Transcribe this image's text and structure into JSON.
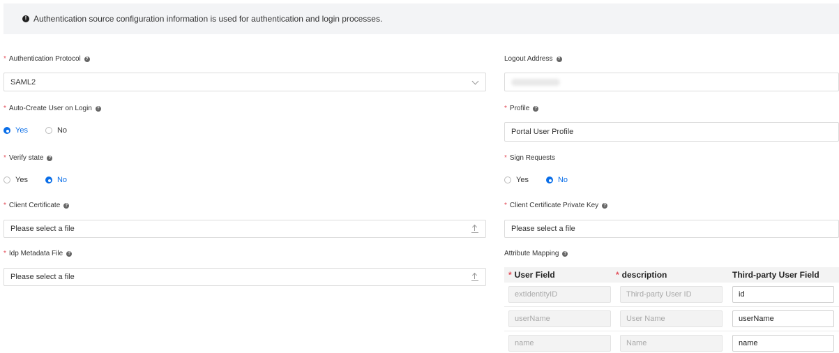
{
  "info": {
    "text": "Authentication source configuration information is used for authentication and login processes."
  },
  "left": {
    "auth_protocol": {
      "label": "Authentication Protocol",
      "required_mark": "*",
      "value": "SAML2"
    },
    "auto_create": {
      "label": "Auto-Create User on Login",
      "required_mark": "*",
      "options": [
        "Yes",
        "No"
      ],
      "selected": "Yes"
    },
    "verify_state": {
      "label": "Verify state",
      "required_mark": "*",
      "options": [
        "Yes",
        "No"
      ],
      "selected": "No"
    },
    "client_cert": {
      "label": "Client Certificate",
      "required_mark": "*",
      "placeholder": "Please select a file"
    },
    "idp_metadata": {
      "label": "Idp Metadata File",
      "required_mark": "*",
      "placeholder": "Please select a file"
    }
  },
  "right": {
    "logout": {
      "label": "Logout Address",
      "value": ""
    },
    "profile": {
      "label": "Profile",
      "required_mark": "*",
      "value": "Portal User Profile"
    },
    "sign_requests": {
      "label": "Sign Requests",
      "required_mark": "*",
      "options": [
        "Yes",
        "No"
      ],
      "selected": "No"
    },
    "client_key": {
      "label": "Client Certificate Private Key",
      "required_mark": "*",
      "placeholder": "Please select a file"
    },
    "attr_mapping": {
      "label": "Attribute Mapping",
      "headers": [
        "User Field",
        "description",
        "Third-party User Field"
      ],
      "rows": [
        {
          "user_field": "extIdentityID",
          "description": "Third-party User ID",
          "third_party": "id"
        },
        {
          "user_field": "userName",
          "description": "User Name",
          "third_party": "userName"
        },
        {
          "user_field": "name",
          "description": "Name",
          "third_party": "name"
        }
      ]
    }
  },
  "icons": {
    "info": "info-icon",
    "help": "question-icon",
    "chevron": "chevron-down-icon",
    "upload": "upload-icon"
  },
  "colors": {
    "accent": "#0a6ee8",
    "required": "#e34d59",
    "info_bg": "#f3f4f6"
  }
}
